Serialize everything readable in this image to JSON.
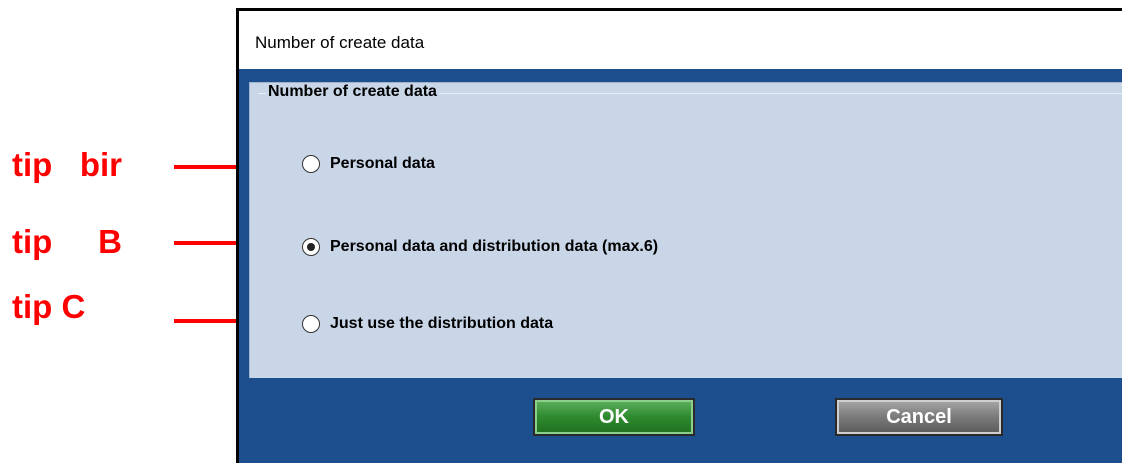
{
  "annotations": [
    {
      "label": "tip   bir"
    },
    {
      "label": "tip     B"
    },
    {
      "label": "tip C"
    }
  ],
  "annotation_color": "#ff0000",
  "dialog": {
    "title": "Number of create data",
    "group_title": "Number of create data",
    "options": [
      {
        "label": "Personal data",
        "selected": false
      },
      {
        "label": "Personal data and distribution data (max.6)",
        "selected": true
      },
      {
        "label": "Just use the distribution data",
        "selected": false
      }
    ],
    "ok_label": "OK",
    "cancel_label": "Cancel",
    "background_color": "#1d4f8f",
    "panel_color": "#c8d6e8"
  }
}
